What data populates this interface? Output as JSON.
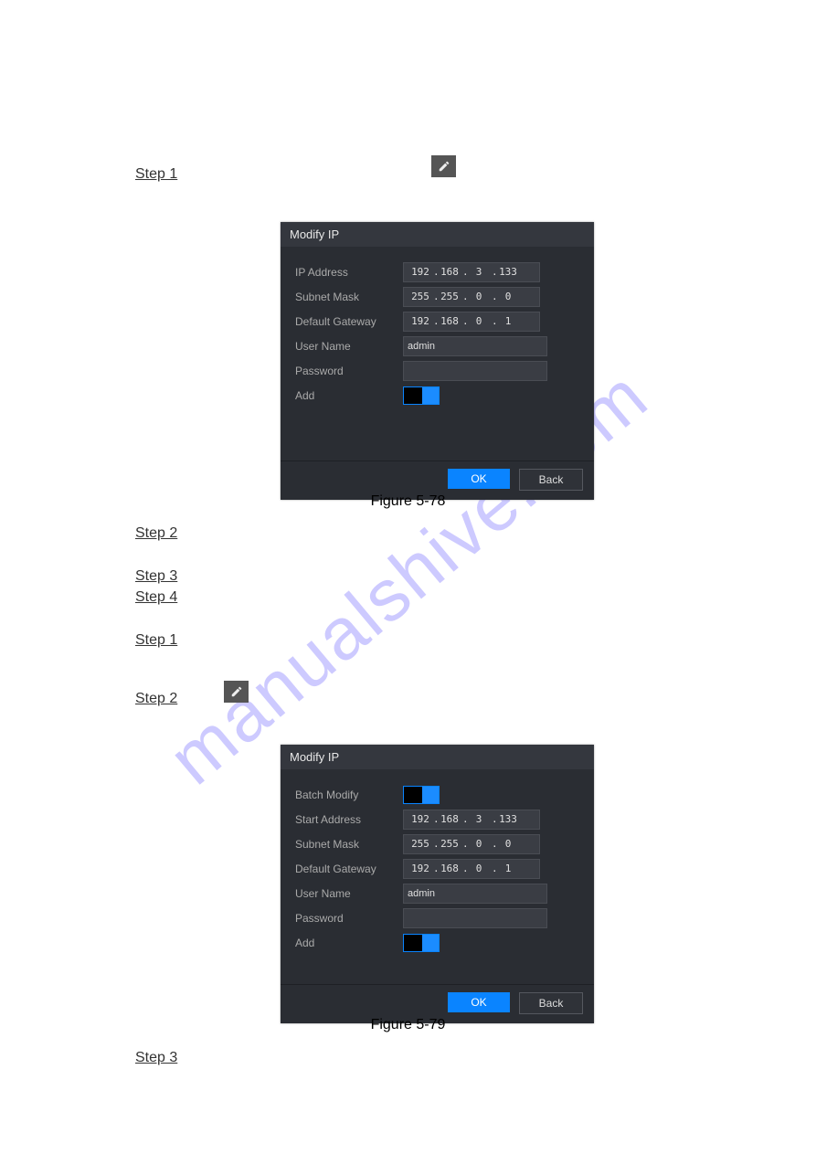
{
  "watermark": "manualshive.com",
  "steps": {
    "s1": "Step 1",
    "s2": "Step 2",
    "s3": "Step 3",
    "s4": "Step 4",
    "s1b": "Step 1",
    "s2b": "Step 2",
    "s3b": "Step 3"
  },
  "fig78_caption": "Figure 5-78",
  "fig79_caption": "Figure 5-79",
  "dialog1": {
    "title": "Modify IP",
    "labels": {
      "ip": "IP Address",
      "mask": "Subnet Mask",
      "gw": "Default Gateway",
      "user": "User Name",
      "pw": "Password",
      "add": "Add"
    },
    "ip": {
      "o1": "192",
      "o2": "168",
      "o3": "3",
      "o4": "133"
    },
    "mask": {
      "o1": "255",
      "o2": "255",
      "o3": "0",
      "o4": "0"
    },
    "gw": {
      "o1": "192",
      "o2": "168",
      "o3": "0",
      "o4": "1"
    },
    "user": "admin",
    "pw": "",
    "ok": "OK",
    "back": "Back"
  },
  "dialog2": {
    "title": "Modify IP",
    "labels": {
      "batch": "Batch Modify",
      "start": "Start Address",
      "mask": "Subnet Mask",
      "gw": "Default Gateway",
      "user": "User Name",
      "pw": "Password",
      "add": "Add"
    },
    "start": {
      "o1": "192",
      "o2": "168",
      "o3": "3",
      "o4": "133"
    },
    "mask": {
      "o1": "255",
      "o2": "255",
      "o3": "0",
      "o4": "0"
    },
    "gw": {
      "o1": "192",
      "o2": "168",
      "o3": "0",
      "o4": "1"
    },
    "user": "admin",
    "pw": "",
    "ok": "OK",
    "back": "Back"
  }
}
